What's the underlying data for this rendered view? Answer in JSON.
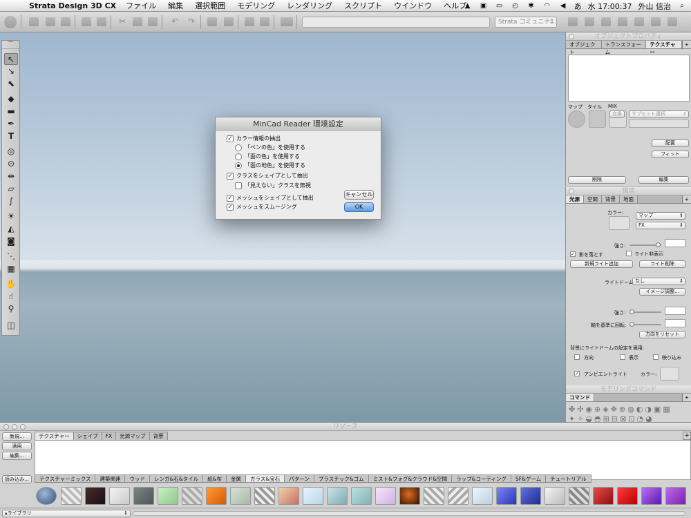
{
  "menubar": {
    "app_name": "Strata Design 3D CX",
    "items": [
      "ファイル",
      "編集",
      "選択範囲",
      "モデリング",
      "レンダリング",
      "スクリプト",
      "ウインドウ",
      "ヘルプ"
    ],
    "clock": "水 17:00:37",
    "user": "外山 信治",
    "input_mode": "あ"
  },
  "toolbar": {
    "community_placeholder": "Strata コミュニテ..."
  },
  "dialog": {
    "title": "MinCad Reader 環境設定",
    "extract_color": "カラー情報の抽出",
    "pen_color": "「ペンの色」を使用する",
    "face_color": "「面の色」を使用する",
    "face_bg_color": "「面の地色」を使用する",
    "class_as_shape": "クラスをシェイプとして抽出",
    "ignore_invisible": "「見えない」クラスを無視",
    "mesh_as_shape": "メッシュをシェイプとして抽出",
    "smooth_mesh": "メッシュをスムージング",
    "cancel": "キャンセル",
    "ok": "OK"
  },
  "object_props": {
    "title": "オブジェクトプロパティ",
    "tabs": [
      "オブジェクト",
      "トランスフォーム",
      "テクスチャー"
    ],
    "map": "マップ",
    "tile": "タイル",
    "mix": "MIX",
    "swap": "交換",
    "subset_select": "サブセット選択",
    "place": "配置",
    "fit": "フィット",
    "delete": "削除",
    "edit": "編集"
  },
  "environment": {
    "title": "環境",
    "tabs": [
      "光源",
      "空間",
      "背景",
      "地面"
    ],
    "color_label": "カラー:",
    "map_select": "マップ",
    "fx_select": "FX",
    "intensity": "強さ:",
    "cast_shadow": "影を落とす",
    "hide_light": "ライト非表示",
    "add_light": "新規ライト追加",
    "delete_light": "ライト削除",
    "light_dome_label": "ライトドーム:",
    "light_dome_value": "なし",
    "image_adjust": "イメージ調整...",
    "intensity2": "強さ:",
    "rotate_axis": "軸を基準に回転:",
    "reset_direction": "方向をリセット",
    "apply_dome": "背景にライトドームの設定を適用:",
    "direction": "方向",
    "display": "表示",
    "clip": "映り込み",
    "ambient": "アンビエントライト",
    "ambient_color": "カラー:"
  },
  "modeling": {
    "title": "モデリングコマンド",
    "tab": "コマンド"
  },
  "resources": {
    "title": "リソース",
    "buttons": [
      "新規...",
      "適用",
      "編集..."
    ],
    "load": "読み込み...",
    "tabs": [
      "テクスチャー",
      "シェイプ",
      "FX",
      "光源マップ",
      "背景"
    ],
    "categories": [
      "テクスチャーミックス",
      "建築関連",
      "ウッド",
      "レンガ&石&タイル",
      "紙&布",
      "金属",
      "ガラス&宝石",
      "パターン",
      "プラスチック&ゴム",
      "ミスト&フォグ&クラウド&空間",
      "ラップ&コーティング",
      "SF&ゲーム",
      "チュートリアル"
    ],
    "library": "ライブラリ"
  }
}
